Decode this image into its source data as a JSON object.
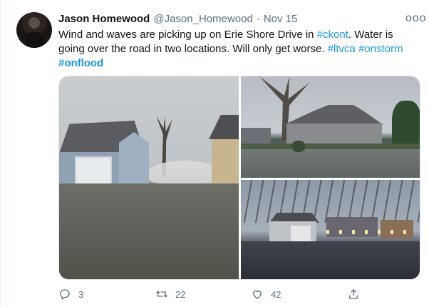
{
  "tweet": {
    "author_name": "Jason Homewood",
    "handle": "@Jason_Homewood",
    "separator": "·",
    "time": "Nov 15",
    "more_label": "ooo",
    "text": {
      "line1_a": "Wind and waves are picking up on Erie Shore Drive in ",
      "line1_tag": "#ckont",
      "line1_b": ".  Water is",
      "line2_a": "going over the road in two locations.  Will only get worse.  ",
      "line2_tag1": "#ltvca",
      "line2_space": " ",
      "line2_tag2": "#onstorm",
      "line3_tag": "#onflood"
    },
    "actions": {
      "reply_count": "3",
      "retweet_count": "22",
      "like_count": "42"
    },
    "icons": {
      "reply": "reply-icon",
      "retweet": "retweet-icon",
      "like": "heart-icon",
      "share": "share-icon",
      "more": "more-icon"
    },
    "colors": {
      "hashtag": "#1b95e0",
      "secondary_text": "#5b7083",
      "primary_text": "#0f1419"
    }
  }
}
